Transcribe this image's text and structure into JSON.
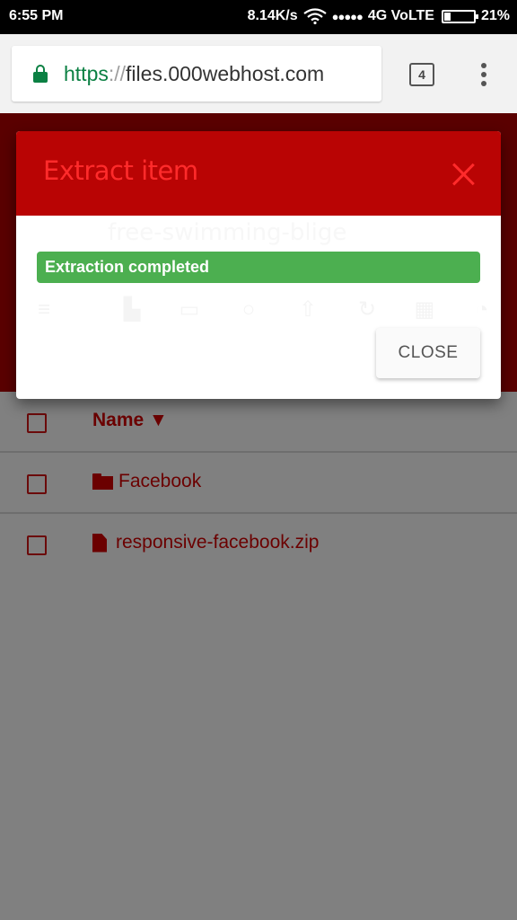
{
  "status_bar": {
    "time": "6:55 PM",
    "network_speed": "8.14K/s",
    "wifi_icon": "wifi-icon",
    "signal_dots": "●●●●●",
    "network_type": "4G VoLTE",
    "battery_percent": "21%",
    "battery_level": 0.21
  },
  "browser": {
    "url_scheme": "https",
    "url_separator": "://",
    "url_host": "files.000webhost.com",
    "tab_count": "4",
    "lock_icon": "lock-icon",
    "menu_icon": "more-vert-icon"
  },
  "background_page": {
    "faded_title": "free-swimming-blige",
    "toolbar_icons": [
      "menu-icon",
      "new-file-icon",
      "new-folder-icon",
      "search-icon",
      "upload-icon",
      "refresh-icon",
      "grid-view-icon",
      "info-icon"
    ],
    "table": {
      "header": "Name ▼",
      "rows": [
        {
          "type": "folder",
          "name": "Facebook"
        },
        {
          "type": "file",
          "name": "responsive-facebook.zip"
        }
      ]
    }
  },
  "modal": {
    "title": "Extract item",
    "close_icon": "close-icon",
    "alert_text": "Extraction completed",
    "close_button": "CLOSE"
  },
  "colors": {
    "modal_header": "#b90404",
    "modal_title": "#ff2b2b",
    "success": "#4caf50",
    "page_header_dimmed": "#5a0000",
    "overlay": "#808080",
    "accent_text_dimmed": "#6b0000",
    "secure_green": "#0b8043"
  }
}
